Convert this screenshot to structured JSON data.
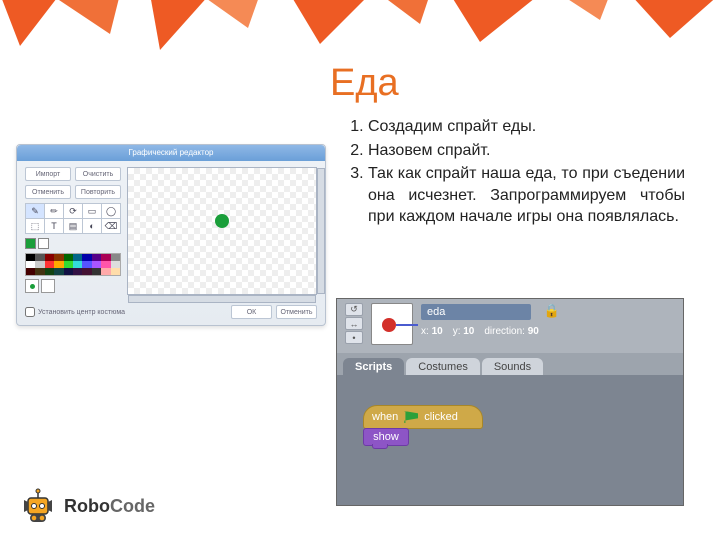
{
  "title": "Еда",
  "instructions": [
    "Создадим спрайт еды.",
    "Назовем спрайт.",
    "Так как спрайт наша еда, то при съедении она исчезнет. Запрограммируем чтобы при каждом начале игры она появлялась."
  ],
  "painter": {
    "header": "Графический редактор",
    "import": "Импорт",
    "clear": "Очистить",
    "undo": "Отменить",
    "redo": "Повторить",
    "set_center": "Установить центр костюма",
    "ok": "ОК",
    "cancel": "Отменить",
    "tool_icons": [
      "✎",
      "✏",
      "⟳",
      "▭",
      "◯",
      "⬚",
      "T",
      "▤",
      "◐",
      "⌫"
    ],
    "swatch_colors": [
      "#1a9e3a",
      "#ffffff"
    ],
    "palette": [
      "#000",
      "#555",
      "#800",
      "#830",
      "#060",
      "#068",
      "#00a",
      "#508",
      "#a05",
      "#888",
      "#fff",
      "#ccc",
      "#f33",
      "#fa0",
      "#3d3",
      "#3dd",
      "#55f",
      "#a5f",
      "#f5a",
      "#ddd",
      "#400",
      "#431",
      "#141",
      "#144",
      "#114",
      "#314",
      "#413",
      "#333",
      "#faa",
      "#fda"
    ]
  },
  "scratch": {
    "sprite_name": "eda",
    "x_label": "x:",
    "x_val": "10",
    "y_label": "y:",
    "y_val": "10",
    "dir_label": "direction:",
    "dir_val": "90",
    "tab_scripts": "Scripts",
    "tab_costumes": "Costumes",
    "tab_sounds": "Sounds",
    "block_when": "when",
    "block_clicked": "clicked",
    "block_show": "show",
    "info_icons": [
      "↺",
      "↔",
      "•"
    ]
  },
  "logo": {
    "brand1": "Robo",
    "brand2": "Code"
  },
  "decor_color": "#ee5a24"
}
